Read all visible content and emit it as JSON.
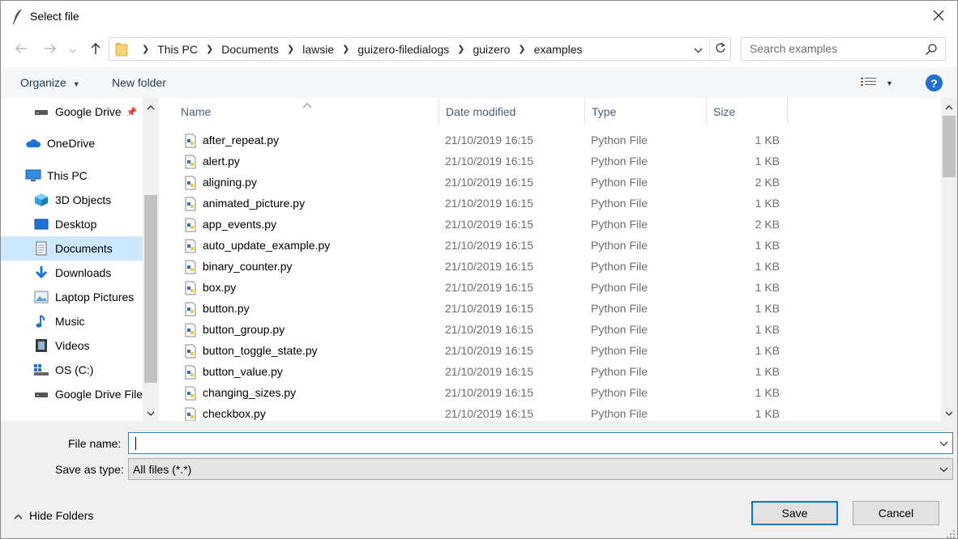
{
  "window": {
    "title": "Select file"
  },
  "address": {
    "crumbs": [
      "This PC",
      "Documents",
      "lawsie",
      "guizero-filedialogs",
      "guizero",
      "examples"
    ]
  },
  "search": {
    "placeholder": "Search examples"
  },
  "commands": {
    "organize": "Organize",
    "new_folder": "New folder"
  },
  "nav_items": [
    {
      "label": "Google Drive",
      "icon": "drive-icon"
    },
    {
      "label": "OneDrive",
      "icon": "cloud-icon"
    },
    {
      "label": "This PC",
      "icon": "computer-icon"
    },
    {
      "label": "3D Objects",
      "icon": "cube-icon"
    },
    {
      "label": "Desktop",
      "icon": "desktop-icon"
    },
    {
      "label": "Documents",
      "icon": "documents-icon"
    },
    {
      "label": "Downloads",
      "icon": "download-icon"
    },
    {
      "label": "Laptop Pictures",
      "icon": "pictures-icon"
    },
    {
      "label": "Music",
      "icon": "music-icon"
    },
    {
      "label": "Videos",
      "icon": "video-icon"
    },
    {
      "label": "OS (C:)",
      "icon": "disk-icon"
    },
    {
      "label": "Google Drive File",
      "icon": "drive-icon"
    }
  ],
  "columns": {
    "name": "Name",
    "date": "Date modified",
    "type": "Type",
    "size": "Size"
  },
  "files": [
    {
      "name": "after_repeat.py",
      "date": "21/10/2019 16:15",
      "type": "Python File",
      "size": "1 KB"
    },
    {
      "name": "alert.py",
      "date": "21/10/2019 16:15",
      "type": "Python File",
      "size": "1 KB"
    },
    {
      "name": "aligning.py",
      "date": "21/10/2019 16:15",
      "type": "Python File",
      "size": "2 KB"
    },
    {
      "name": "animated_picture.py",
      "date": "21/10/2019 16:15",
      "type": "Python File",
      "size": "1 KB"
    },
    {
      "name": "app_events.py",
      "date": "21/10/2019 16:15",
      "type": "Python File",
      "size": "2 KB"
    },
    {
      "name": "auto_update_example.py",
      "date": "21/10/2019 16:15",
      "type": "Python File",
      "size": "1 KB"
    },
    {
      "name": "binary_counter.py",
      "date": "21/10/2019 16:15",
      "type": "Python File",
      "size": "1 KB"
    },
    {
      "name": "box.py",
      "date": "21/10/2019 16:15",
      "type": "Python File",
      "size": "1 KB"
    },
    {
      "name": "button.py",
      "date": "21/10/2019 16:15",
      "type": "Python File",
      "size": "1 KB"
    },
    {
      "name": "button_group.py",
      "date": "21/10/2019 16:15",
      "type": "Python File",
      "size": "1 KB"
    },
    {
      "name": "button_toggle_state.py",
      "date": "21/10/2019 16:15",
      "type": "Python File",
      "size": "1 KB"
    },
    {
      "name": "button_value.py",
      "date": "21/10/2019 16:15",
      "type": "Python File",
      "size": "1 KB"
    },
    {
      "name": "changing_sizes.py",
      "date": "21/10/2019 16:15",
      "type": "Python File",
      "size": "1 KB"
    },
    {
      "name": "checkbox.py",
      "date": "21/10/2019 16:15",
      "type": "Python File",
      "size": "1 KB"
    }
  ],
  "footer": {
    "file_name_label": "File name:",
    "file_name_value": "",
    "save_type_label": "Save as type:",
    "save_type_value": "All files (*.*)",
    "hide_folders": "Hide Folders",
    "save": "Save",
    "cancel": "Cancel"
  },
  "colors": {
    "accent": "#0078d7",
    "selected": "#cce8ff",
    "header_text": "#4c607a",
    "command_text": "#1e395b"
  }
}
